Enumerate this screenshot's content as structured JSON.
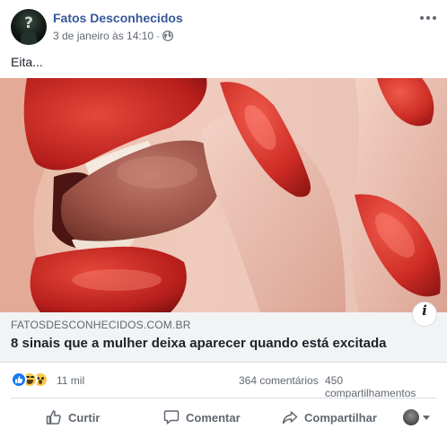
{
  "post": {
    "page_name": "Fatos Desconhecidos",
    "timestamp": "3 de janeiro às 14:10",
    "meta_separator": "·",
    "privacy_icon": "globe-icon",
    "more_icon": "more-dots-icon",
    "avatar_text": "?",
    "text": "Eita..."
  },
  "link_preview": {
    "domain": "FATOSDESCONHECIDOS.COM.BR",
    "title": "8 sinais que a mulher deixa aparecer quando está excitada",
    "info_label": "i"
  },
  "stats": {
    "reaction_icons": [
      "like-reaction-icon",
      "haha-reaction-icon",
      "wow-reaction-icon"
    ],
    "reaction_count": "11 mil",
    "comments": "364 comentários",
    "shares": "450 compartilhamentos"
  },
  "actions": {
    "like": "Curtir",
    "comment": "Comentar",
    "share": "Compartilhar"
  },
  "colors": {
    "page_link": "#385898",
    "secondary_text": "#606770",
    "link_box_bg": "#f2f3f5",
    "like_blue": "#1877f2",
    "reaction_yellow": "#f7c84b"
  }
}
